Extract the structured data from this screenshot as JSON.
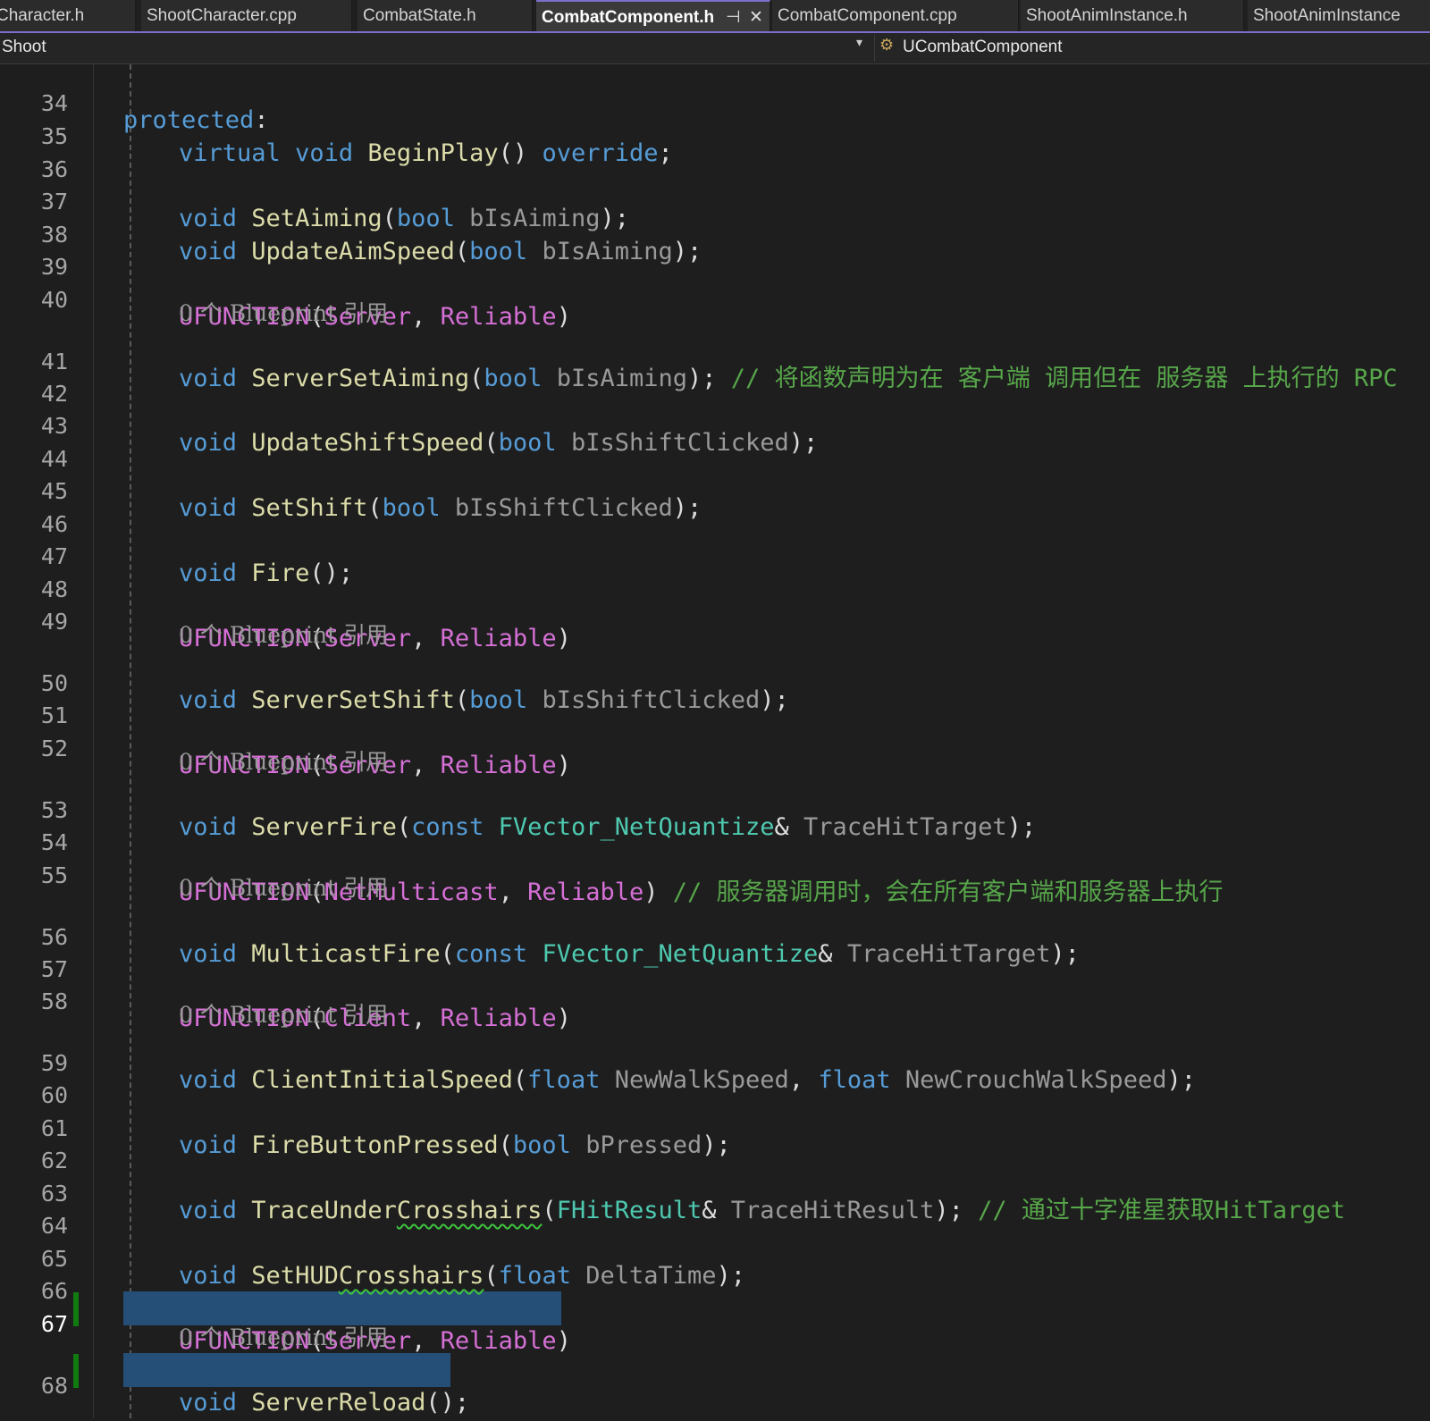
{
  "tabs": [
    {
      "label": "Character.h",
      "active": false
    },
    {
      "label": "ShootCharacter.cpp",
      "active": false
    },
    {
      "label": "CombatState.h",
      "active": false
    },
    {
      "label": "CombatComponent.h",
      "active": true
    },
    {
      "label": "CombatComponent.cpp",
      "active": false
    },
    {
      "label": "ShootAnimInstance.h",
      "active": false
    },
    {
      "label": "ShootAnimInstance",
      "active": false
    }
  ],
  "tab_pin_glyph": "⊣",
  "tab_close_glyph": "✕",
  "navbar": {
    "project": "Shoot",
    "chevron": "▾",
    "class_icon": "⚙",
    "class_name": "UCombatComponent"
  },
  "hint_text": "0 个 Blueprint 引用",
  "colors": {
    "keyword": "#569cd6",
    "function": "#dcdcaa",
    "macro": "#d670d6",
    "type": "#4ec9b0",
    "comment": "#57a64a",
    "selection": "#264f78",
    "change_bar": "#107c10"
  },
  "lines": {
    "n34": "34",
    "n35": "35",
    "n36": "36",
    "n37": "37",
    "n38": "38",
    "n39": "39",
    "n40": "40",
    "n41": "41",
    "n42": "42",
    "n43": "43",
    "n44": "44",
    "n45": "45",
    "n46": "46",
    "n47": "47",
    "n48": "48",
    "n49": "49",
    "n50": "50",
    "n51": "51",
    "n52": "52",
    "n53": "53",
    "n54": "54",
    "n55": "55",
    "n56": "56",
    "n57": "57",
    "n58": "58",
    "n59": "59",
    "n60": "60",
    "n61": "61",
    "n62": "62",
    "n63": "63",
    "n64": "64",
    "n65": "65",
    "n66": "66",
    "n67": "67",
    "n68": "68"
  },
  "code": {
    "l34": [
      "protected",
      ":"
    ],
    "l35": [
      "virtual",
      " ",
      "void",
      " ",
      "BeginPlay",
      "() ",
      "override",
      ";"
    ],
    "l37": [
      "void",
      " ",
      "SetAiming",
      "(",
      "bool",
      " ",
      "bIsAiming",
      ");"
    ],
    "l38": [
      "void",
      " ",
      "UpdateAimSpeed",
      "(",
      "bool",
      " ",
      "bIsAiming",
      ");"
    ],
    "l40": [
      "UFUNCTION",
      "(",
      "Server",
      ", ",
      "Reliable",
      ")"
    ],
    "l41": [
      "void",
      " ",
      "ServerSetAiming",
      "(",
      "bool",
      " ",
      "bIsAiming",
      "); ",
      "// 将函数声明为在 客户端 调用但在 服务器 上执行的 RPC"
    ],
    "l43": [
      "void",
      " ",
      "UpdateShiftSpeed",
      "(",
      "bool",
      " ",
      "bIsShiftClicked",
      ");"
    ],
    "l45": [
      "void",
      " ",
      "SetShift",
      "(",
      "bool",
      " ",
      "bIsShiftClicked",
      ");"
    ],
    "l47": [
      "void",
      " ",
      "Fire",
      "();"
    ],
    "l49": [
      "UFUNCTION",
      "(",
      "Server",
      ", ",
      "Reliable",
      ")"
    ],
    "l50": [
      "void",
      " ",
      "ServerSetShift",
      "(",
      "bool",
      " ",
      "bIsShiftClicked",
      ");"
    ],
    "l52": [
      "UFUNCTION",
      "(",
      "Server",
      ", ",
      "Reliable",
      ")"
    ],
    "l53": [
      "void",
      " ",
      "ServerFire",
      "(",
      "const",
      " ",
      "FVector_NetQuantize",
      "& ",
      "TraceHitTarget",
      ");"
    ],
    "l55": [
      "UFUNCTION",
      "(",
      "NetMulticast",
      ", ",
      "Reliable",
      ") ",
      "// 服务器调用时，会在所有客户端和服务器上执行"
    ],
    "l56": [
      "void",
      " ",
      "MulticastFire",
      "(",
      "const",
      " ",
      "FVector_NetQuantize",
      "& ",
      "TraceHitTarget",
      ");"
    ],
    "l58": [
      "UFUNCTION",
      "(",
      "Client",
      ", ",
      "Reliable",
      ")"
    ],
    "l59": [
      "void",
      " ",
      "ClientInitialSpeed",
      "(",
      "float",
      " ",
      "NewWalkSpeed",
      ", ",
      "float",
      " ",
      "NewCrouchWalkSpeed",
      ");"
    ],
    "l61": [
      "void",
      " ",
      "FireButtonPressed",
      "(",
      "bool",
      " ",
      "bPressed",
      ");"
    ],
    "l63": [
      "void",
      " ",
      "TraceUnder",
      "Crosshairs",
      "(",
      "FHitResult",
      "& ",
      "TraceHitResult",
      "); ",
      "// 通过十字准星获取HitTarget"
    ],
    "l65": [
      "void",
      " ",
      "SetHUD",
      "Crosshairs",
      "(",
      "float",
      " ",
      "DeltaTime",
      ");"
    ],
    "l67": [
      "UFUNCTION",
      "(",
      "Server",
      ", ",
      "Reliable",
      ")"
    ],
    "l68": [
      "void",
      " ",
      "ServerReload",
      "();"
    ]
  }
}
